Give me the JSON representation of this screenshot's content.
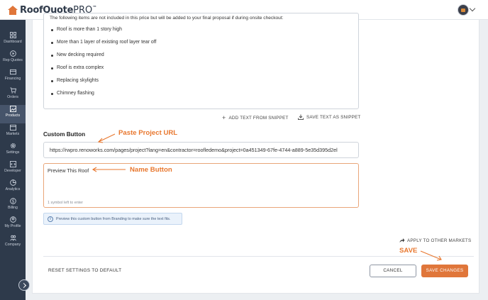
{
  "app": {
    "logo_text": "RoofQuote",
    "logo_suffix": "PRO",
    "logo_tm": "™"
  },
  "sidebar": {
    "items": [
      {
        "label": "Dashboard",
        "icon": "dashboard-icon"
      },
      {
        "label": "Rep Quotes",
        "icon": "play-circle-icon"
      },
      {
        "label": "Financing",
        "icon": "financing-icon"
      },
      {
        "label": "Orders",
        "icon": "cart-icon"
      },
      {
        "label": "Products",
        "icon": "products-icon",
        "active": true
      },
      {
        "label": "Markets",
        "icon": "calendar-icon"
      },
      {
        "label": "Settings",
        "icon": "gear-icon"
      },
      {
        "label": "Developer",
        "icon": "code-icon"
      },
      {
        "label": "Analytics",
        "icon": "pie-chart-icon"
      },
      {
        "label": "Billing",
        "icon": "dollar-icon"
      },
      {
        "label": "My Profile",
        "icon": "user-icon"
      },
      {
        "label": "Company",
        "icon": "company-icon"
      }
    ]
  },
  "snippet_box": {
    "intro": "The following items are not included in this price but will be added to your final proposal if during onsite checkout:",
    "bullets": [
      "Roof is more than 1 story high",
      "More than 1 layer of existing roof layer tear off",
      "New decking required",
      "Roof is extra complex",
      "Replacing skylights",
      "Chimney flashing"
    ]
  },
  "snippet_actions": {
    "add_text": "ADD TEXT FROM SNIPPET",
    "save_text": "SAVE TEXT AS SNIPPET"
  },
  "custom_button": {
    "title": "Custom Button",
    "url_value": "https://rwpro.renoworks.com/pages/project?lang=en&contractor=roofledemo&project=0a451349-67fe-4744-a889-5e35d395d2el",
    "name_value": "Preview This Roof",
    "char_count": "1 symbol left to enter",
    "info_text": "Preview this custom button from Branding to make sure the text fits."
  },
  "apply_markets": "APPLY TO OTHER MARKETS",
  "footer": {
    "reset": "RESET SETTINGS TO DEFAULT",
    "cancel": "CANCEL",
    "save": "SAVE CHANGES"
  },
  "annotations": {
    "paste_url": "Paste Project URL",
    "name_button": "Name Button",
    "save": "SAVE",
    "color": "#e8772e"
  },
  "colors": {
    "sidebar_bg": "#2e3a4b",
    "accent": "#e0763a"
  }
}
